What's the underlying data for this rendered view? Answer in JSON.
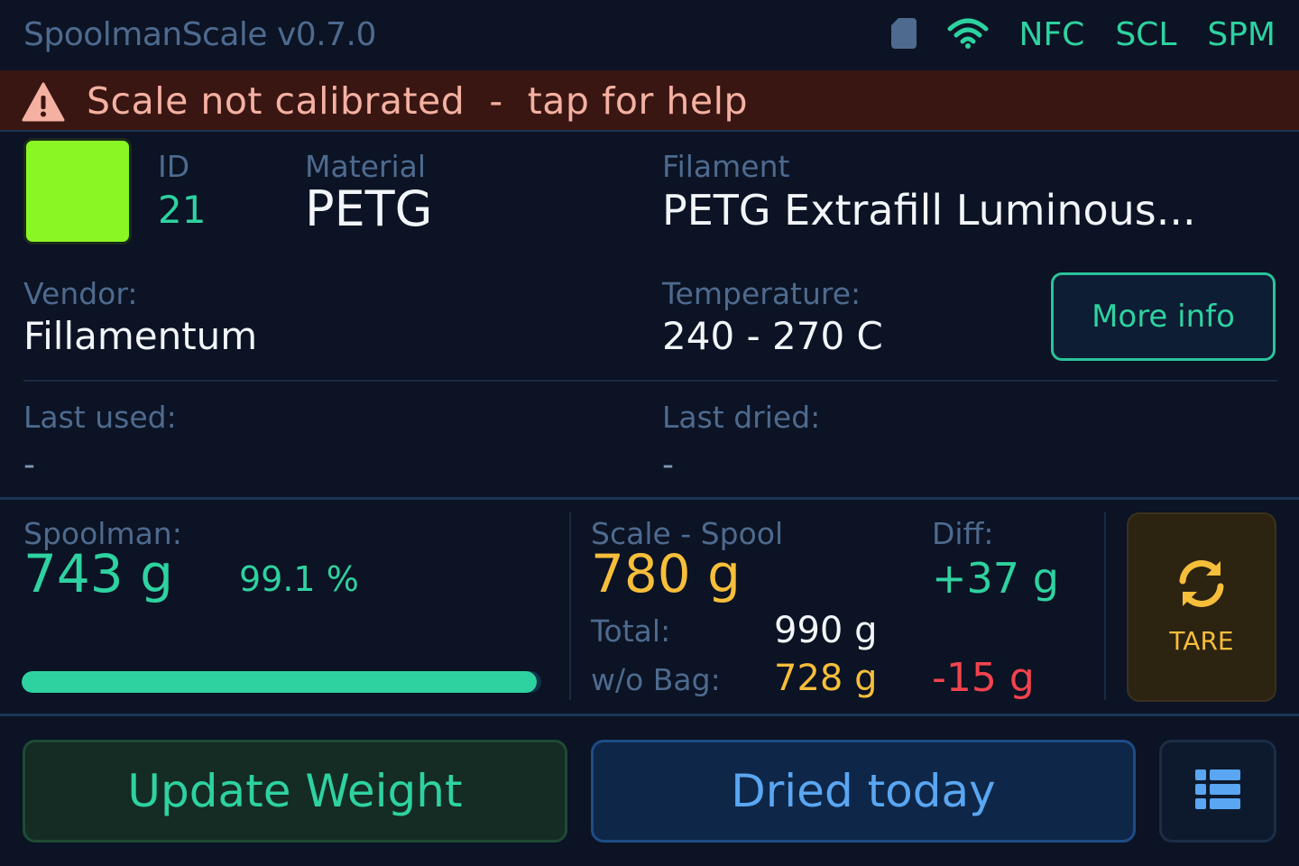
{
  "header": {
    "title": "SpoolmanScale v0.7.0",
    "indicators": [
      "NFC",
      "SCL",
      "SPM"
    ],
    "icons": [
      "sd-card-icon",
      "wifi-icon"
    ]
  },
  "alert": {
    "text": "Scale not calibrated  -  tap for help",
    "icon": "warning-icon"
  },
  "spool": {
    "color_hex": "#8AF724",
    "id_label": "ID",
    "id": "21",
    "material_label": "Material",
    "material": "PETG",
    "filament_label": "Filament",
    "filament": "PETG Extrafill Luminous...",
    "vendor_label": "Vendor:",
    "vendor": "Fillamentum",
    "temperature_label": "Temperature:",
    "temperature": "240 - 270 C",
    "more_info_label": "More info",
    "last_used_label": "Last used:",
    "last_used": "-",
    "last_dried_label": "Last dried:",
    "last_dried": "-"
  },
  "weights": {
    "spoolman_label": "Spoolman:",
    "spoolman": "743 g",
    "spoolman_percent": "99.1 %",
    "progress_fraction": 0.991,
    "scale_label": "Scale - Spool",
    "scale": "780 g",
    "diff_label": "Diff:",
    "diff": "+37 g",
    "total_label": "Total:",
    "total": "990 g",
    "without_bag_label": "w/o Bag:",
    "without_bag": "728 g",
    "without_bag_diff": "-15 g",
    "tare_label": "TARE"
  },
  "actions": {
    "update_weight": "Update Weight",
    "dried_today": "Dried today",
    "menu_icon": "list-icon"
  },
  "colors": {
    "accent_green": "#2ED2A0",
    "accent_yellow": "#F7BE3A",
    "error_red": "#F2434D",
    "accent_blue": "#5AA6F2",
    "alert_bg": "#3A1612"
  }
}
